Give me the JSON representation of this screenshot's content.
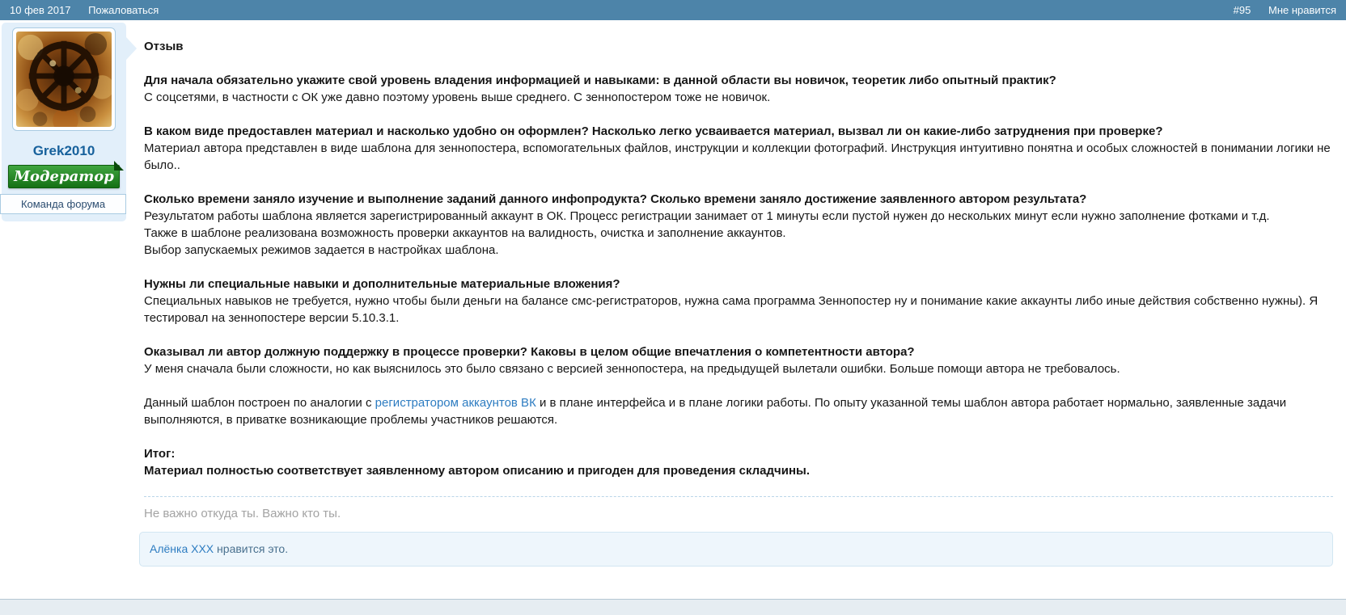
{
  "topbar": {
    "date": "10 фев 2017",
    "report": "Пожаловаться",
    "post_number": "#95",
    "like": "Мне нравится"
  },
  "user": {
    "name": "Grek2010",
    "badge": "Модератор",
    "team": "Команда форума",
    "avatar_icon": "black-sun-mosaic-avatar"
  },
  "post": {
    "blocks": [
      [
        [
          {
            "t": "Отзыв",
            "b": true
          }
        ]
      ],
      [
        [
          {
            "t": "Для начала обязательно укажите свой уровень владения информацией и навыками: в данной области вы новичок, теоретик либо опытный практик?",
            "b": true
          }
        ],
        [
          {
            "t": "С соцсетями, в частности с ОК уже давно поэтому уровень выше среднего. С зеннопостером тоже не новичок."
          }
        ]
      ],
      [
        [
          {
            "t": "В каком виде предоставлен материал и насколько удобно он оформлен? Насколько легко усваивается материал, вызвал ли он какие-либо затруднения при проверке?",
            "b": true
          }
        ],
        [
          {
            "t": "Материал автора представлен в виде шаблона для зеннопостера, вспомогательных файлов, инструкции и коллекции фотографий. Инструкция интуитивно понятна и особых сложностей в понимании логики не было.."
          }
        ]
      ],
      [
        [
          {
            "t": "Сколько времени заняло изучение и выполнение заданий данного инфопродукта? Сколько времени заняло достижение заявленного автором результата?",
            "b": true
          }
        ],
        [
          {
            "t": "Результатом работы шаблона является зарегистрированный аккаунт в ОК. Процесс регистрации занимает от 1 минуты если пустой нужен до нескольких минут если нужно заполнение фотками и т.д."
          }
        ],
        [
          {
            "t": "Также в шаблоне реализована возможность проверки аккаунтов на валидность, очистка и заполнение аккаунтов."
          }
        ],
        [
          {
            "t": "Выбор запускаемых режимов задается в настройках шаблона."
          }
        ]
      ],
      [
        [
          {
            "t": "Нужны ли специальные навыки и дополнительные материальные вложения?",
            "b": true
          }
        ],
        [
          {
            "t": "Специальных навыков не требуется, нужно чтобы были деньги на балансе смс-регистраторов, нужна сама программа Зеннопостер ну и понимание какие аккаунты либо иные действия собственно нужны). Я тестировал на зеннопостере версии 5.10.3.1."
          }
        ]
      ],
      [
        [
          {
            "t": "Оказывал ли автор должную поддержку в процессе проверки? Каковы в целом общие впечатления о компетентности автора?",
            "b": true
          }
        ],
        [
          {
            "t": "У меня сначала были сложности, но как выяснилось это было связано с версией зеннопостера, на предыдущей вылетали ошибки. Больше помощи автора не требовалось."
          }
        ]
      ],
      [
        [
          {
            "t": "Данный шаблон построен по аналогии с "
          },
          {
            "t": "регистратором аккаунтов ВК",
            "link": true
          },
          {
            "t": " и в плане интерфейса и в плане логики работы. По опыту указанной темы шаблон автора работает нормально, заявленные задачи выполняются, в приватке возникающие проблемы участников решаются."
          }
        ]
      ],
      [
        [
          {
            "t": "Итог:",
            "b": true
          }
        ],
        [
          {
            "t": "Материал полностью соответствует заявленному автором описанию и пригоден для проведения складчины.",
            "b": true
          }
        ]
      ]
    ],
    "signature": "Не важно откуда ты. Важно кто ты."
  },
  "likes": {
    "user": "Алёнка XXX",
    "suffix": " нравится это."
  },
  "colors": {
    "topbar_bg": "#4d84a9",
    "user_block_bg": "#e2effa",
    "username_blue": "#17619c",
    "moderator_green": "#157015",
    "link_blue": "#2d7cc1",
    "likes_bg": "#eef6fc",
    "signature_gray": "#a3a3a3"
  }
}
